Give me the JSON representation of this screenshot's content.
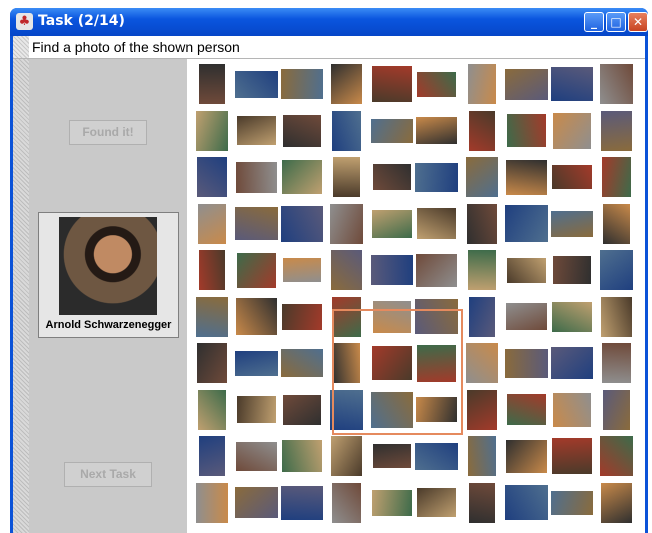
{
  "window": {
    "title": "Task (2/14)"
  },
  "instruction": "Find a photo of the shown person",
  "left_panel": {
    "found_button": "Found it!",
    "person_name": "Arnold Schwarzenegger",
    "next_button": "Next Task"
  },
  "photo_count": 100,
  "photo_palette": [
    "#6f4a3a",
    "#4f6f8f",
    "#8a6b3c",
    "#2f2f2f",
    "#a33a2a",
    "#3d6b4a",
    "#c98a4a",
    "#5a5a7a",
    "#1f3f7f",
    "#8f8f8f",
    "#c0a070",
    "#4a3a2a"
  ]
}
